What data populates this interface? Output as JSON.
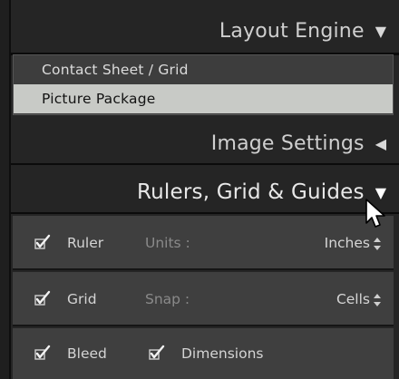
{
  "panel": {
    "layout_engine": {
      "title": "Layout Engine",
      "items": [
        {
          "label": "Contact Sheet / Grid",
          "selected": false
        },
        {
          "label": "Picture Package",
          "selected": true
        }
      ]
    },
    "image_settings": {
      "title": "Image Settings",
      "state": "collapsed"
    },
    "rulers_grid_guides": {
      "title": "Rulers, Grid & Guides",
      "state": "expanded",
      "ruler": {
        "label": "Ruler",
        "checked": true,
        "units_label": "Units :",
        "units_value": "Inches"
      },
      "grid": {
        "label": "Grid",
        "checked": true,
        "snap_label": "Snap :",
        "snap_value": "Cells"
      },
      "bleed": {
        "label": "Bleed",
        "checked": true
      },
      "dimensions": {
        "label": "Dimensions",
        "checked": true
      }
    }
  },
  "icons": {
    "expand": "triangle-down-icon",
    "collapse": "triangle-left-icon",
    "check": "checkmark-icon",
    "stepper": "up-down-stepper-icon",
    "cursor": "mouse-pointer-icon"
  },
  "colors": {
    "panel_bg": "#252525",
    "list_bg": "#3d3d3d",
    "selected_bg": "#c8cac6",
    "row_bg": "#3f3f3f",
    "text": "#d4d4d4",
    "muted_text": "#8a8a8a"
  }
}
